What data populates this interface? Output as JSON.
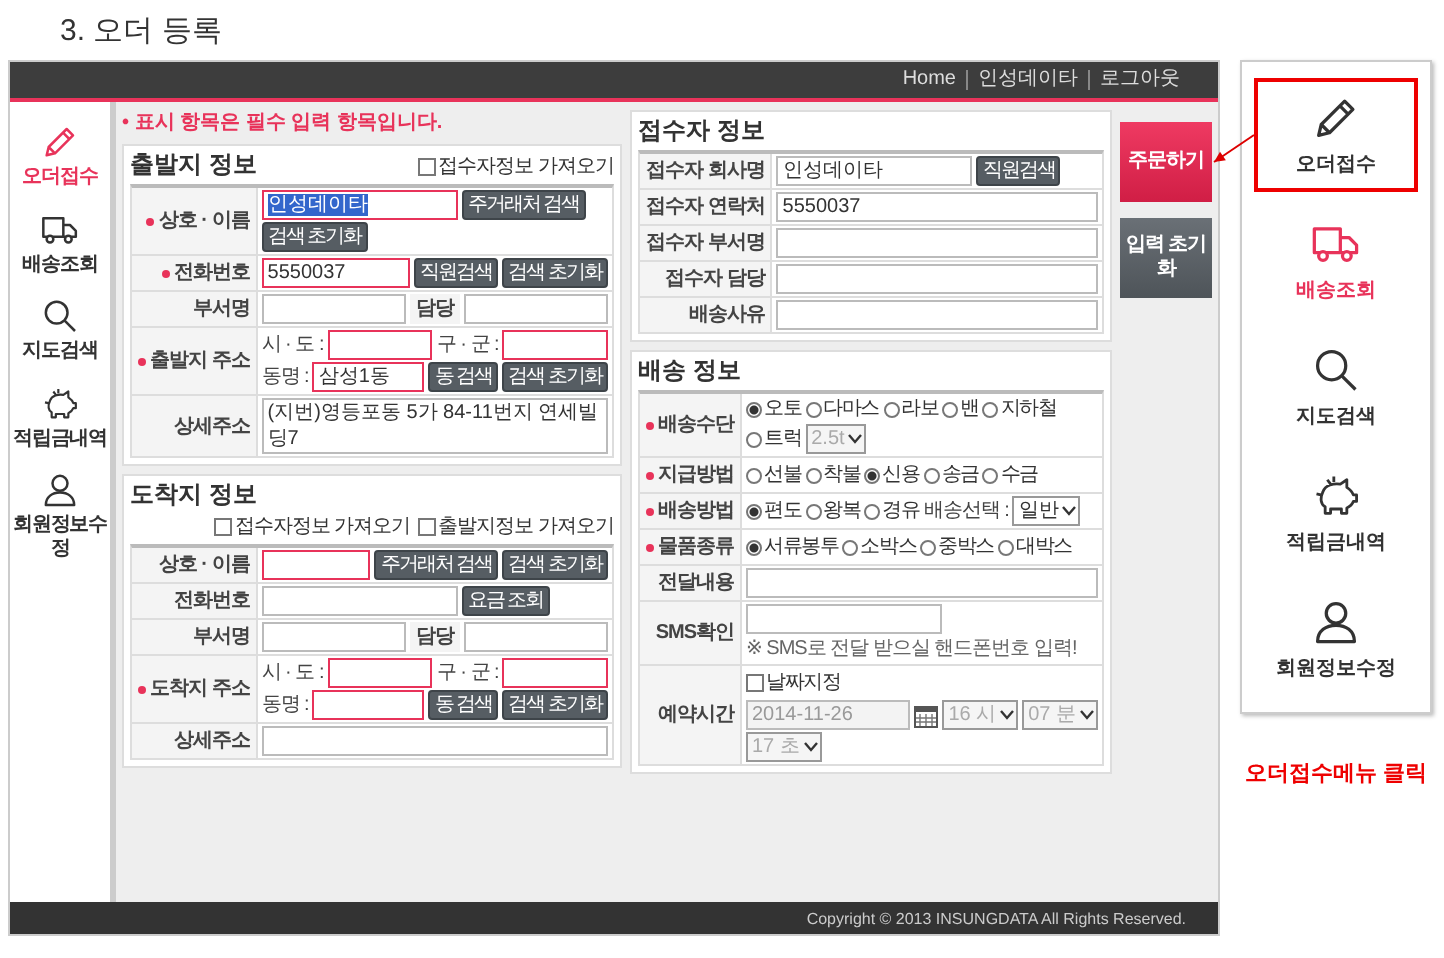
{
  "page_title": "3. 오더 등록",
  "header": {
    "links": [
      "Home",
      "인성데이타",
      "로그아웃"
    ]
  },
  "sidebar": {
    "items": [
      {
        "label": "오더접수",
        "selected": true
      },
      {
        "label": "배송조회",
        "selected": false
      },
      {
        "label": "지도검색",
        "selected": false
      },
      {
        "label": "적립금내역",
        "selected": false
      },
      {
        "label": "회원정보수정",
        "selected": false
      }
    ]
  },
  "notice": "• 표시 항목은 필수 입력 항목입니다.",
  "departure": {
    "title": "출발지 정보",
    "options": [
      {
        "label": "접수자정보 가져오기",
        "checked": false
      }
    ],
    "rows": [
      {
        "label": "상호 · 이름",
        "required": true,
        "lines": [
          [
            {
              "kind": "input",
              "value": "인성데이타",
              "highlight": true,
              "selected": true
            },
            {
              "kind": "button",
              "label": "주거래처 검색"
            },
            {
              "kind": "button",
              "label": "검색 초기화"
            }
          ]
        ]
      },
      {
        "label": "전화번호",
        "required": true,
        "lines": [
          [
            {
              "kind": "input",
              "value": "5550037",
              "highlight": true,
              "selected": false
            },
            {
              "kind": "button",
              "label": "직원검색"
            },
            {
              "kind": "button",
              "label": "검색 초기화"
            }
          ]
        ]
      },
      {
        "label": "부서명",
        "required": false,
        "lines": [
          [
            {
              "kind": "input",
              "highlight": false
            },
            {
              "kind": "sublabel",
              "text": "담당"
            },
            {
              "kind": "input",
              "highlight": false
            }
          ]
        ]
      },
      {
        "label": "출발지 주소",
        "required": true,
        "lines": [
          [
            {
              "kind": "text",
              "text": "시 · 도 :"
            },
            {
              "kind": "input",
              "highlight": true
            },
            {
              "kind": "text",
              "text": "구 · 군 :"
            },
            {
              "kind": "input",
              "highlight": true
            }
          ],
          [
            {
              "kind": "text",
              "text": "동명 :"
            },
            {
              "kind": "input",
              "value": "삼성1동",
              "highlight": true,
              "selected": false
            },
            {
              "kind": "button",
              "label": "동 검색"
            },
            {
              "kind": "button",
              "label": "검색 초기화"
            }
          ]
        ]
      },
      {
        "label": "상세주소",
        "required": false,
        "lines": [
          [
            {
              "kind": "input",
              "value": "(지번)영등포동 5가 84-11번지 연세빌딩7",
              "highlight": false,
              "selected": false
            }
          ]
        ]
      }
    ]
  },
  "arrival": {
    "title": "도착지 정보",
    "options": [
      {
        "label": "접수자정보 가져오기",
        "checked": false
      },
      {
        "label": "출발지정보 가져오기",
        "checked": false
      }
    ],
    "rows": [
      {
        "label": "상호 · 이름",
        "required": false,
        "lines": [
          [
            {
              "kind": "input",
              "highlight": true
            },
            {
              "kind": "button",
              "label": "주거래처 검색"
            },
            {
              "kind": "button",
              "label": "검색 초기화"
            }
          ]
        ]
      },
      {
        "label": "전화번호",
        "required": false,
        "lines": [
          [
            {
              "kind": "input",
              "highlight": false
            },
            {
              "kind": "button",
              "label": "요금 조회"
            }
          ]
        ]
      },
      {
        "label": "부서명",
        "required": false,
        "lines": [
          [
            {
              "kind": "input",
              "highlight": false
            },
            {
              "kind": "sublabel",
              "text": "담당"
            },
            {
              "kind": "input",
              "highlight": false
            }
          ]
        ]
      },
      {
        "label": "도착지 주소",
        "required": true,
        "lines": [
          [
            {
              "kind": "text",
              "text": "시 · 도 :"
            },
            {
              "kind": "input",
              "highlight": true
            },
            {
              "kind": "text",
              "text": "구 · 군 :"
            },
            {
              "kind": "input",
              "highlight": true
            }
          ],
          [
            {
              "kind": "text",
              "text": "동명 :"
            },
            {
              "kind": "input",
              "highlight": true
            },
            {
              "kind": "button",
              "label": "동 검색"
            },
            {
              "kind": "button",
              "label": "검색 초기화"
            }
          ]
        ]
      },
      {
        "label": "상세주소",
        "required": false,
        "lines": [
          [
            {
              "kind": "input",
              "highlight": false
            }
          ]
        ]
      }
    ]
  },
  "receiver": {
    "title": "접수자 정보",
    "rows": [
      {
        "label": "접수자 회사명",
        "required": false,
        "lines": [
          [
            {
              "kind": "input",
              "value": "인성데이타",
              "highlight": false,
              "selected": false
            },
            {
              "kind": "button",
              "label": "직원검색"
            }
          ]
        ]
      },
      {
        "label": "접수자 연락처",
        "required": false,
        "lines": [
          [
            {
              "kind": "input",
              "value": "5550037",
              "highlight": false,
              "selected": false
            }
          ]
        ]
      },
      {
        "label": "접수자 부서명",
        "required": false,
        "lines": [
          [
            {
              "kind": "input",
              "highlight": false
            }
          ]
        ]
      },
      {
        "label": "접수자 담당",
        "required": false,
        "lines": [
          [
            {
              "kind": "input",
              "highlight": false
            }
          ]
        ]
      },
      {
        "label": "배송사유",
        "required": false,
        "lines": [
          [
            {
              "kind": "input",
              "highlight": false
            }
          ]
        ]
      }
    ]
  },
  "actions": [
    {
      "label": "주문하기",
      "kind": "primary"
    },
    {
      "label": "입력 초기화",
      "kind": "secondary"
    }
  ],
  "delivery": {
    "title": "배송 정보",
    "rows": [
      {
        "label": "배송수단",
        "required": true,
        "lines": [
          [
            {
              "kind": "radio",
              "label": "오토",
              "selected": true
            },
            {
              "kind": "radio",
              "label": "다마스",
              "selected": false
            },
            {
              "kind": "radio",
              "label": "라보",
              "selected": false
            },
            {
              "kind": "radio",
              "label": "밴",
              "selected": false
            },
            {
              "kind": "radio",
              "label": "지하철",
              "selected": false
            },
            {
              "kind": "radio",
              "label": "트럭",
              "selected": false
            },
            {
              "kind": "select",
              "value": "2.5t",
              "disabled": true
            }
          ]
        ]
      },
      {
        "label": "지급방법",
        "required": true,
        "lines": [
          [
            {
              "kind": "radio",
              "label": "선불",
              "selected": false
            },
            {
              "kind": "radio",
              "label": "착불",
              "selected": false
            },
            {
              "kind": "radio",
              "label": "신용",
              "selected": true
            },
            {
              "kind": "radio",
              "label": "송금",
              "selected": false
            },
            {
              "kind": "radio",
              "label": "수금",
              "selected": false
            }
          ]
        ]
      },
      {
        "label": "배송방법",
        "required": true,
        "lines": [
          [
            {
              "kind": "radio",
              "label": "편도",
              "selected": true
            },
            {
              "kind": "radio",
              "label": "왕복",
              "selected": false
            },
            {
              "kind": "radio",
              "label": "경유",
              "selected": false
            },
            {
              "kind": "text",
              "text": "배송선택 :"
            },
            {
              "kind": "select",
              "value": "일반",
              "disabled": false
            }
          ]
        ]
      },
      {
        "label": "물품종류",
        "required": true,
        "lines": [
          [
            {
              "kind": "radio",
              "label": "서류봉투",
              "selected": true
            },
            {
              "kind": "radio",
              "label": "소박스",
              "selected": false
            },
            {
              "kind": "radio",
              "label": "중박스",
              "selected": false
            },
            {
              "kind": "radio",
              "label": "대박스",
              "selected": false
            }
          ]
        ]
      },
      {
        "label": "전달내용",
        "required": false,
        "lines": [
          [
            {
              "kind": "input",
              "highlight": false
            }
          ]
        ]
      },
      {
        "label": "SMS확인",
        "required": false,
        "lines": [
          [
            {
              "kind": "input",
              "highlight": false
            },
            {
              "kind": "note",
              "text": "※ SMS로 전달 받으실 핸드폰번호 입력!"
            }
          ]
        ]
      },
      {
        "label": "예약시간",
        "required": false,
        "lines": [
          [
            {
              "kind": "checkbox",
              "label": "날짜지정",
              "checked": false
            }
          ],
          [
            {
              "kind": "input",
              "value": "2014-11-26",
              "highlight": false,
              "selected": false,
              "disabled": true
            },
            {
              "kind": "calendar"
            },
            {
              "kind": "select",
              "value": "16 시",
              "disabled": true
            },
            {
              "kind": "select",
              "value": "07 분",
              "disabled": true
            },
            {
              "kind": "select",
              "value": "17 초",
              "disabled": true
            }
          ]
        ]
      }
    ]
  },
  "footer": "Copyright © 2013 INSUNGDATA All Rights Reserved.",
  "callout": {
    "items": [
      {
        "label": "오더접수",
        "selected": false,
        "boxed": true
      },
      {
        "label": "배송조회",
        "selected": true,
        "boxed": false
      },
      {
        "label": "지도검색",
        "selected": false,
        "boxed": false
      },
      {
        "label": "적립금내역",
        "selected": false,
        "boxed": false
      },
      {
        "label": "회원정보수정",
        "selected": false,
        "boxed": false
      }
    ],
    "caption": "오더접수메뉴 클릭"
  }
}
